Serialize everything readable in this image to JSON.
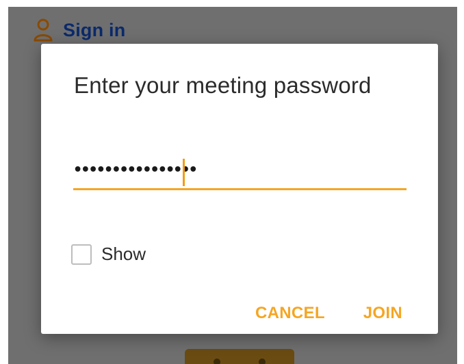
{
  "background": {
    "signin_label": "Sign in",
    "signin_icon": "person-icon"
  },
  "dialog": {
    "title": "Enter your meeting password",
    "password": {
      "masked_value": "••••••••••••••••",
      "field_type": "password"
    },
    "show_checkbox": {
      "label": "Show",
      "checked": false
    },
    "buttons": {
      "cancel": "CANCEL",
      "join": "JOIN"
    }
  },
  "colors": {
    "accent": "#f5a623",
    "signin_text": "#0b2a6b",
    "overlay_bg": "#6f6f6f"
  }
}
